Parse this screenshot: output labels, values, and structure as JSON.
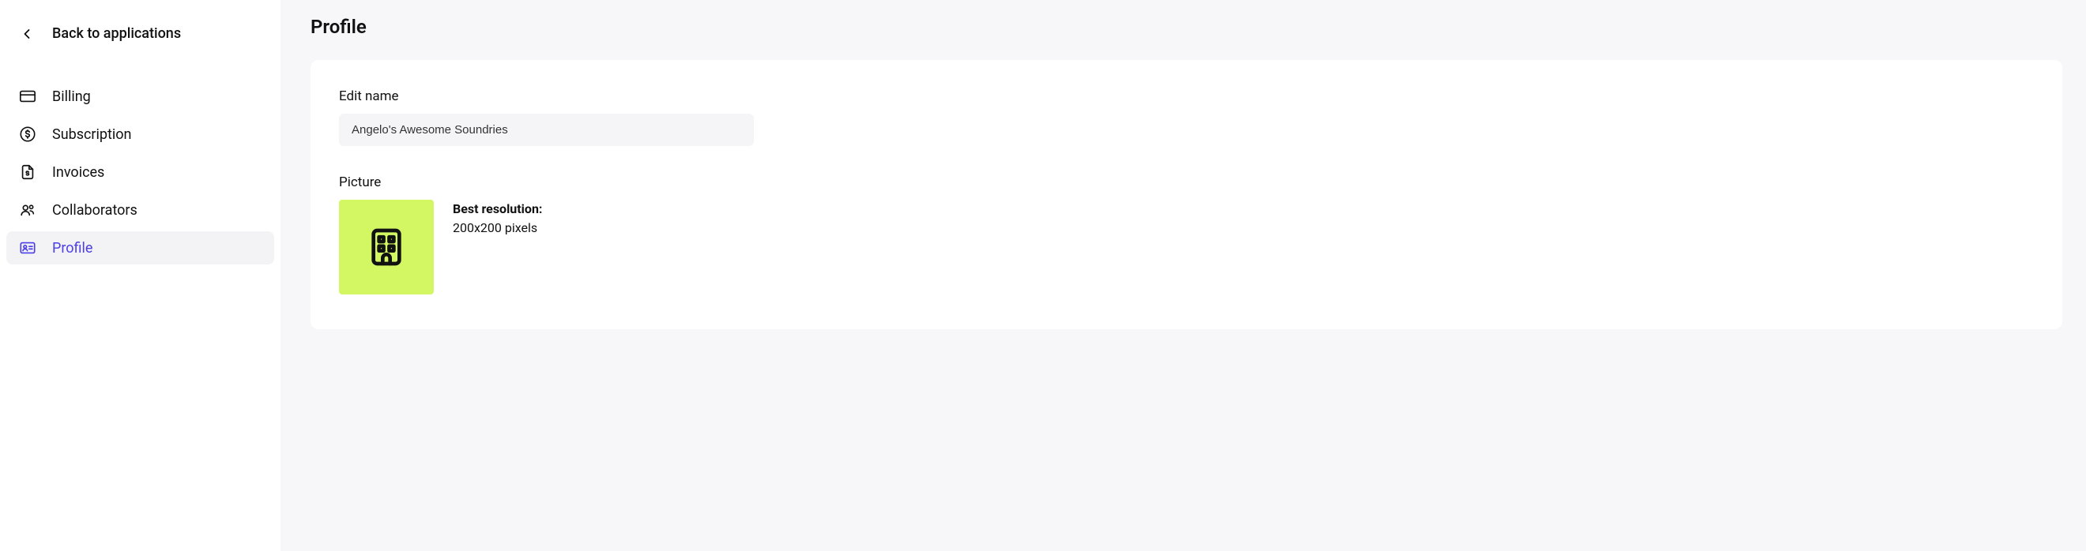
{
  "sidebar": {
    "back_label": "Back to applications",
    "items": [
      {
        "label": "Billing",
        "active": false
      },
      {
        "label": "Subscription",
        "active": false
      },
      {
        "label": "Invoices",
        "active": false
      },
      {
        "label": "Collaborators",
        "active": false
      },
      {
        "label": "Profile",
        "active": true
      }
    ]
  },
  "page": {
    "title": "Profile"
  },
  "profile": {
    "edit_name_label": "Edit name",
    "name_value": "Angelo's Awesome Soundries",
    "picture_label": "Picture",
    "best_resolution_label": "Best resolution:",
    "best_resolution_value": "200x200 pixels",
    "picture_bg_color": "#d3f762"
  }
}
